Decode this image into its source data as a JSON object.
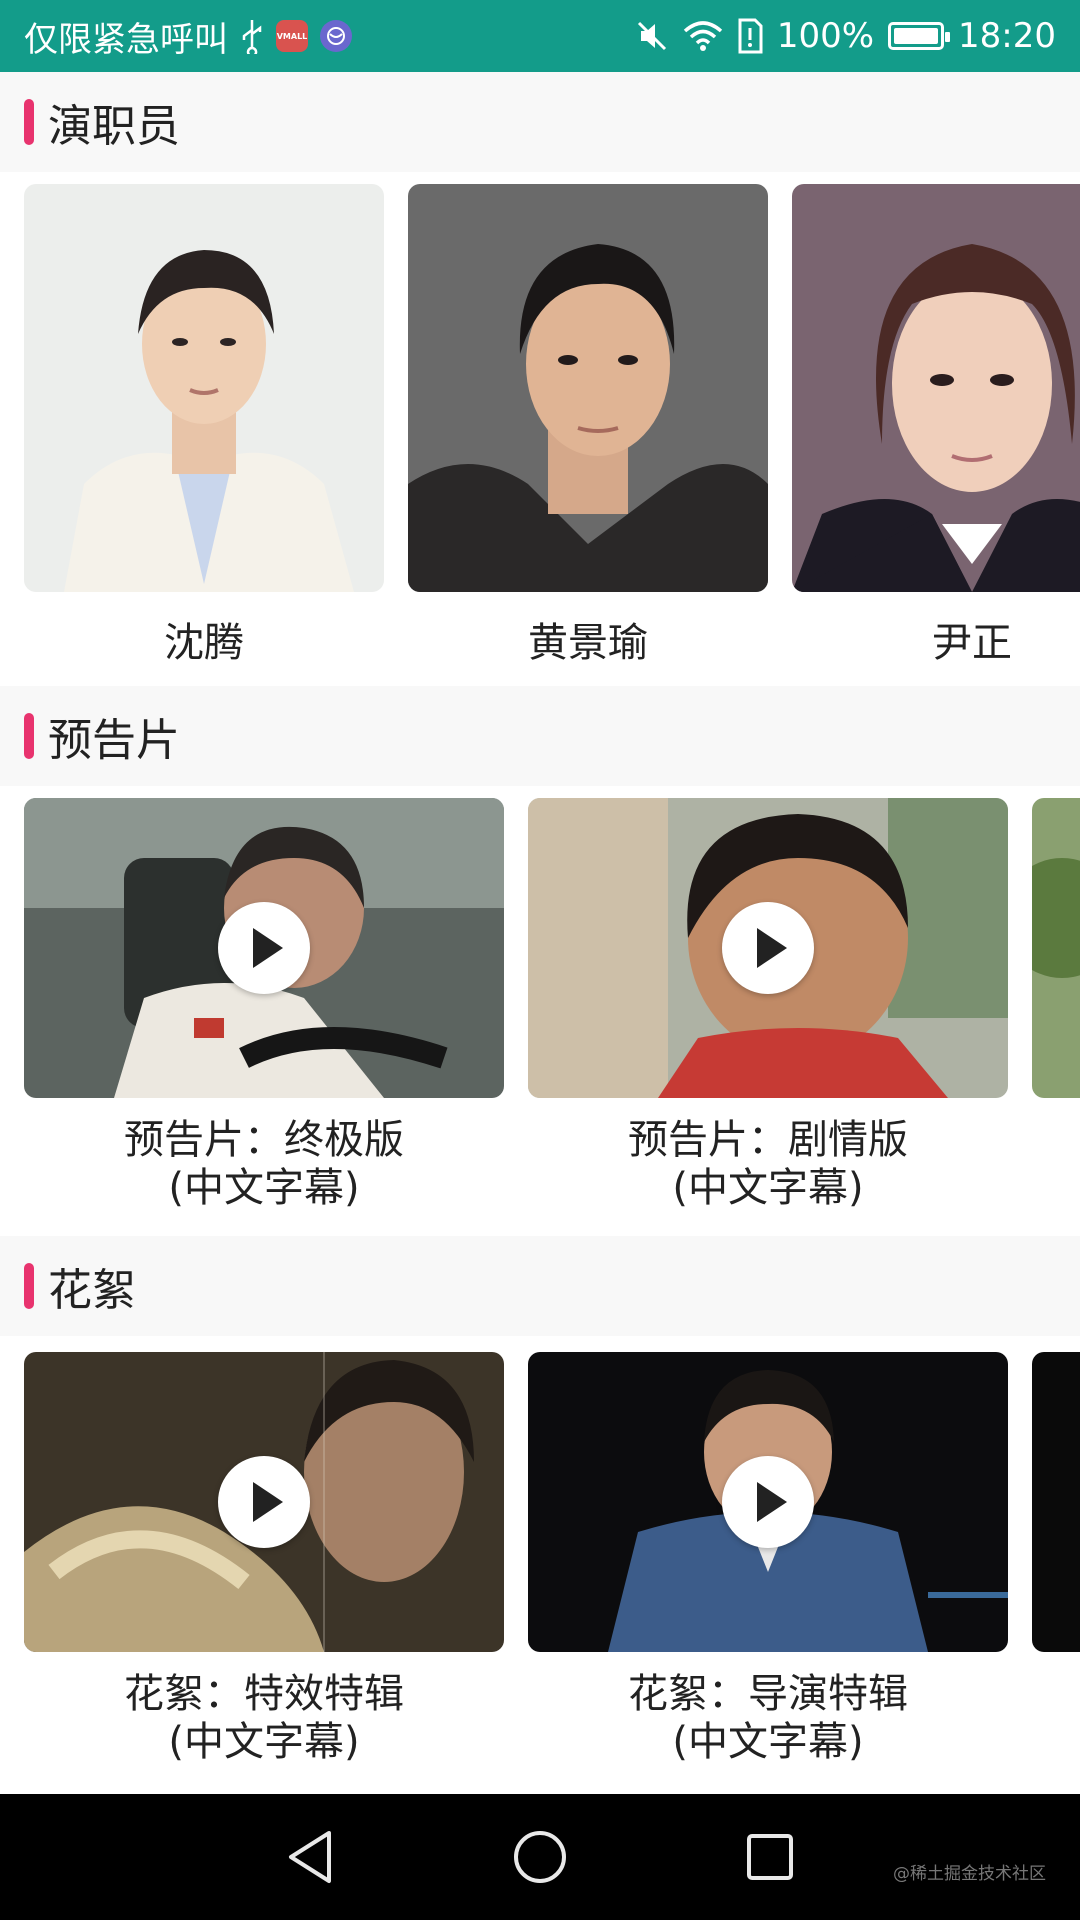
{
  "status_bar": {
    "carrier": "仅限紧急呼叫",
    "battery": "100%",
    "time": "18:20",
    "icons": [
      "usb-icon",
      "mall-app-icon",
      "sphere-app-icon",
      "mute-icon",
      "wifi-icon",
      "sim-alert-icon",
      "battery-icon"
    ],
    "mall_badge": "VMALL"
  },
  "sections": {
    "cast": {
      "title": "演职员"
    },
    "trailers": {
      "title": "预告片"
    },
    "featurettes": {
      "title": "花絮"
    }
  },
  "cast": [
    {
      "name": "沈腾"
    },
    {
      "name": "黄景瑜"
    },
    {
      "name": "尹正"
    }
  ],
  "trailers": [
    {
      "line1": "预告片：终极版",
      "line2": "(中文字幕)"
    },
    {
      "line1": "预告片：剧情版",
      "line2": "(中文字幕)"
    }
  ],
  "featurettes": [
    {
      "line1": "花絮：特效特辑",
      "line2": "(中文字幕)"
    },
    {
      "line1": "花絮：导演特辑",
      "line2": "(中文字幕)"
    }
  ],
  "watermark": "@稀土掘金技术社区",
  "colors": {
    "status_bar": "#139c8a",
    "accent": "#e8336e",
    "section_bg": "#f8f8f8",
    "nav_bar": "#000000"
  }
}
